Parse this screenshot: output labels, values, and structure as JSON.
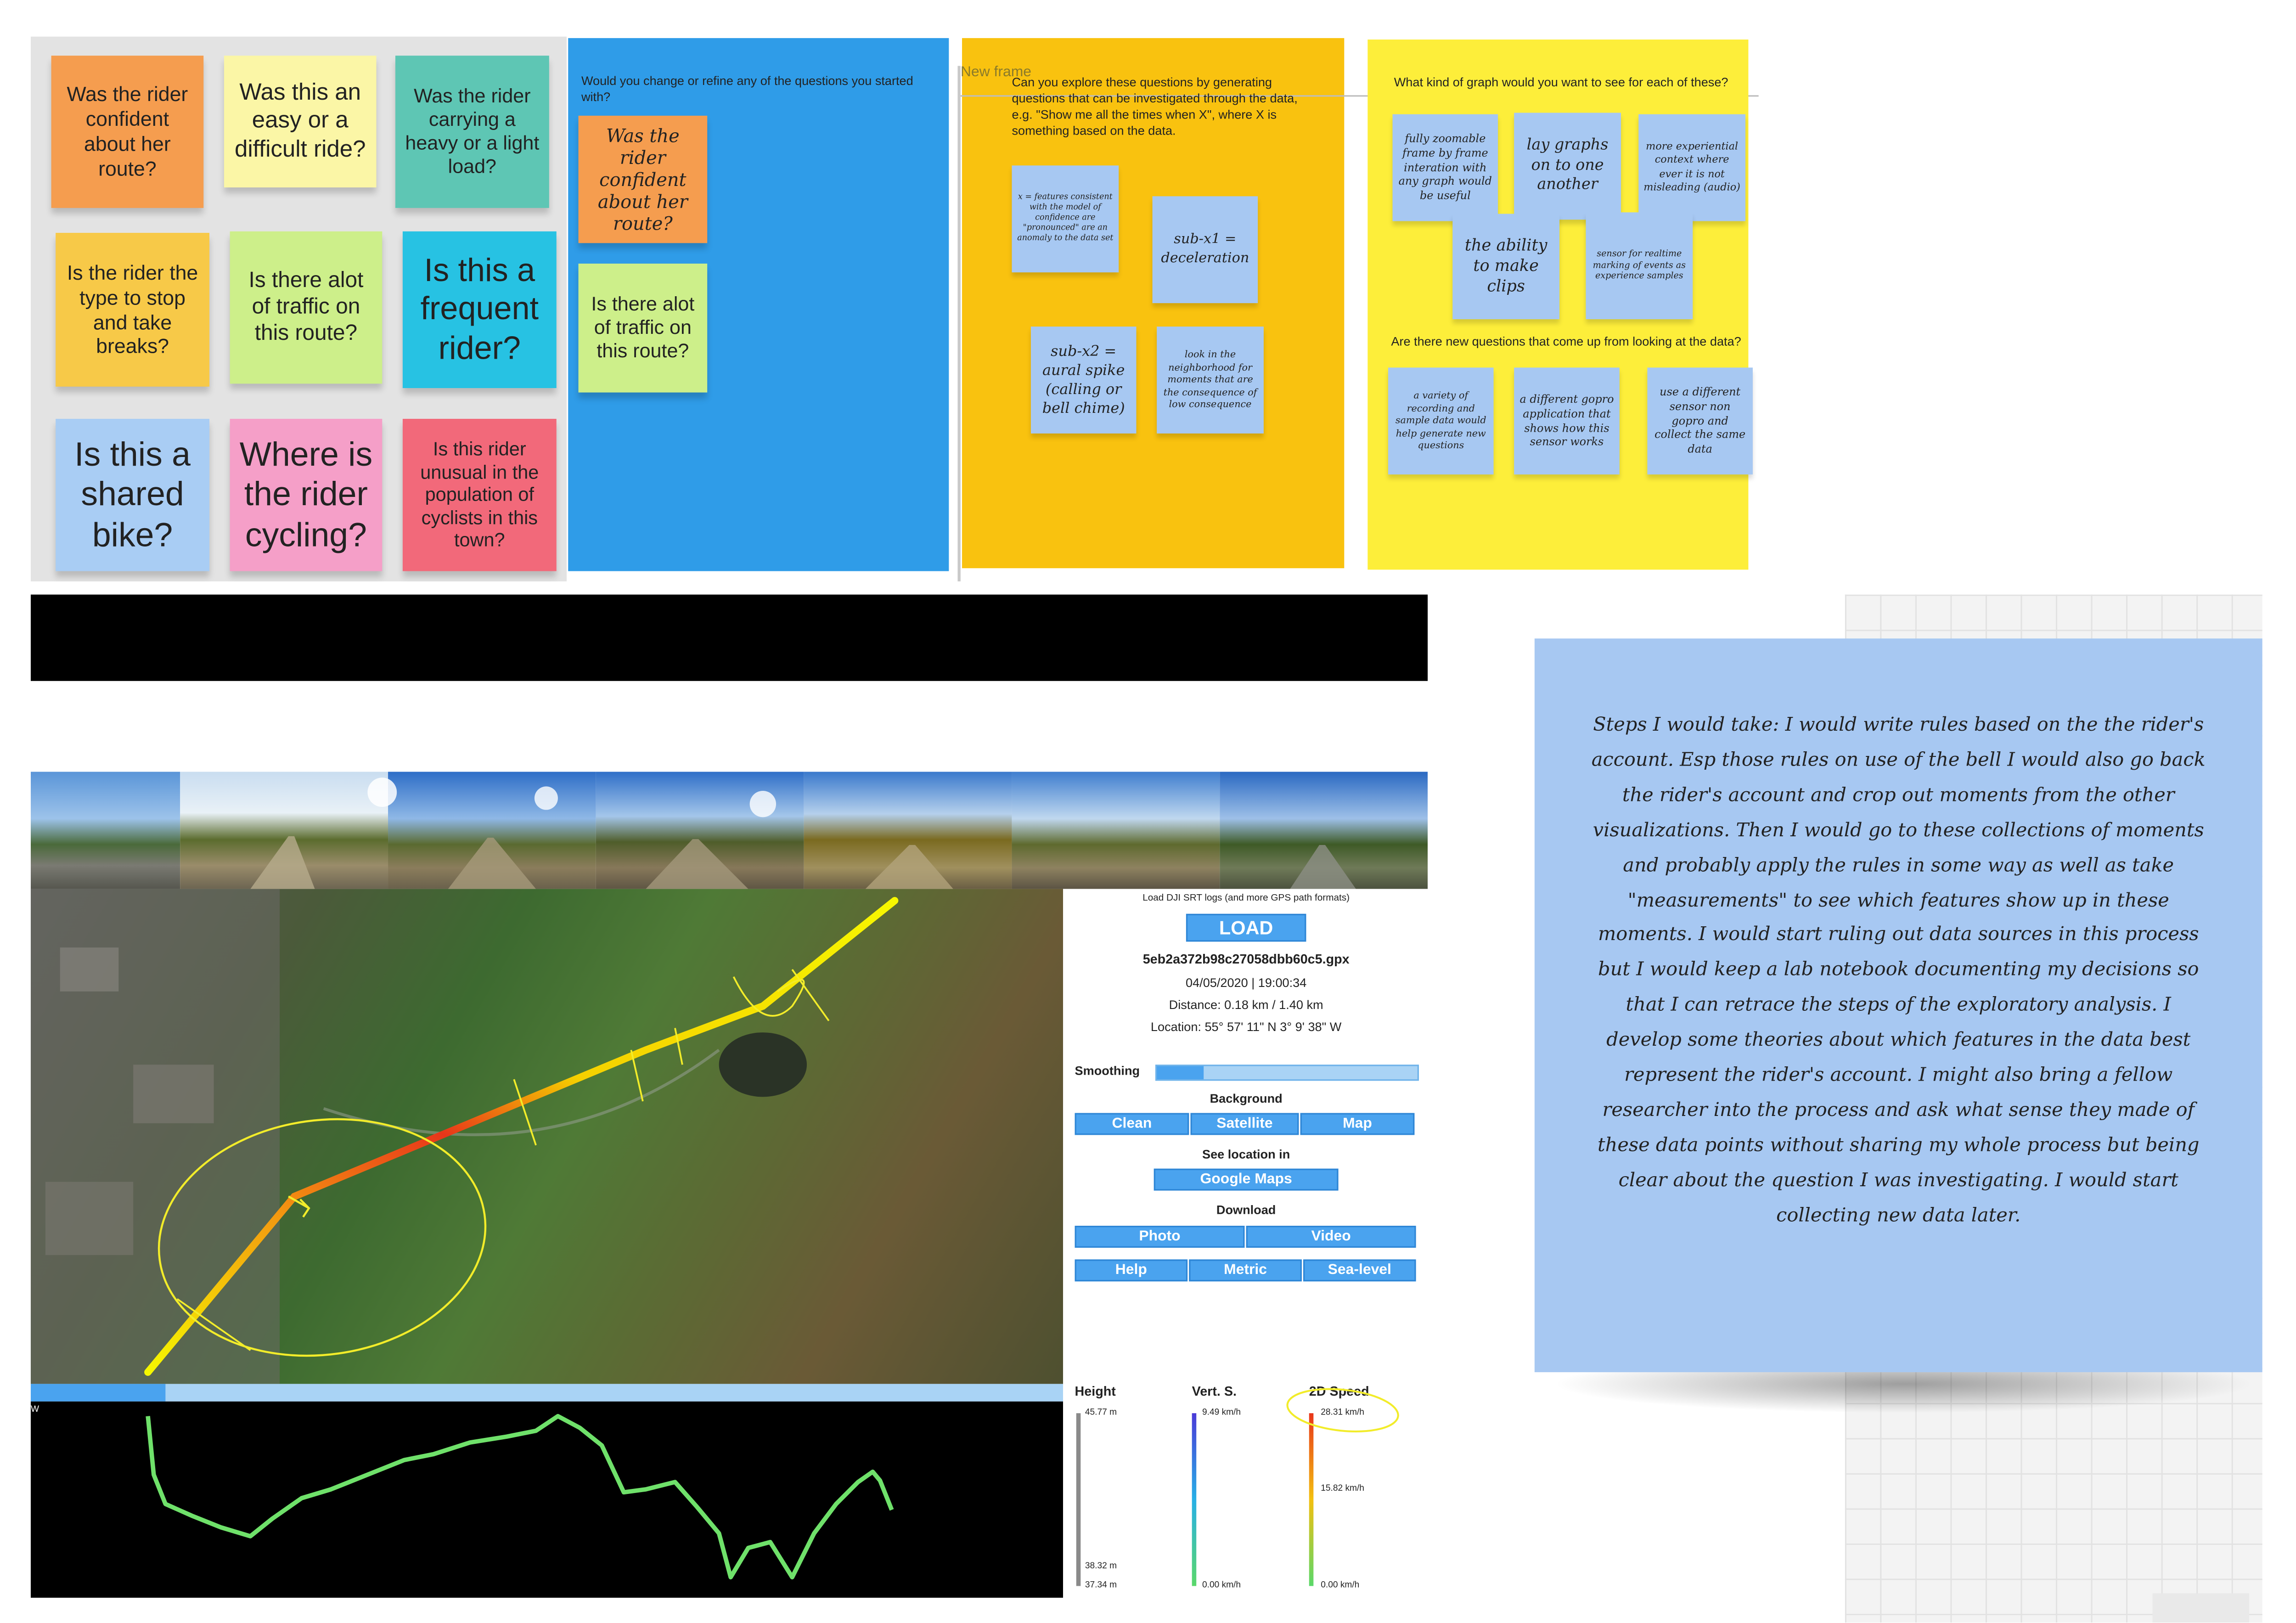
{
  "frame1": {
    "notes": [
      {
        "text": "Was the rider confident about her route?",
        "color": "#f59d4f"
      },
      {
        "text": "Was this an easy or a difficult ride?",
        "color": "#fbf6a6"
      },
      {
        "text": "Was the rider carrying a heavy or a light load?",
        "color": "#5ec6b4"
      },
      {
        "text": "Is the rider the type to stop and take breaks?",
        "color": "#f7c948"
      },
      {
        "text": "Is there alot of traffic on this route?",
        "color": "#cdef8a"
      },
      {
        "text": "Is this a frequent rider?",
        "color": "#27c2e3"
      },
      {
        "text": "Is this a shared bike?",
        "color": "#a9cdf4"
      },
      {
        "text": "Where is the rider cycling?",
        "color": "#f59fc8"
      },
      {
        "text": "Is this rider unusual in the population of cyclists in this town?",
        "color": "#f2697a"
      }
    ]
  },
  "frame2": {
    "question": "Would you change or refine any of the questions you started with?",
    "notes": [
      {
        "text": "Was the rider confident about her route?"
      },
      {
        "text": "Is there alot of traffic on this route?"
      }
    ]
  },
  "frame3": {
    "label": "New frame",
    "question": "Can you explore these questions by generating questions that can be investigated through the data, e.g. \"Show me all the times when X\", where X is something based on the data.",
    "notes": [
      {
        "text": "x = features consistent with the model of confidence are \"pronounced\" are an anomaly to the data set"
      },
      {
        "text": "sub-x1 = deceleration"
      },
      {
        "text": "sub-x2 = aural spike (calling or bell chime)"
      },
      {
        "text": "look in the neighborhood for moments that are the consequence of low consequence"
      }
    ]
  },
  "frame4": {
    "question1": "What kind of graph would you want to see for each of these?",
    "notes1": [
      {
        "text": "fully zoomable frame by frame interation with any graph would be useful"
      },
      {
        "text": "lay graphs on to one another"
      },
      {
        "text": "more experiential context where ever it is not misleading (audio)"
      },
      {
        "text": "the ability to make clips"
      },
      {
        "text": "sensor for realtime marking of events as experience samples"
      }
    ],
    "question2": "Are there new questions that come up from looking at the data?",
    "notes2": [
      {
        "text": "a variety of recording and sample data would help generate new questions"
      },
      {
        "text": "a different gopro application that shows how this sensor works"
      },
      {
        "text": "use a different sensor non gopro and collect the same data"
      }
    ]
  },
  "big_note": {
    "text": "Steps I would take: I would write rules based on the the rider's account. Esp those rules on use of the bell I would also go back the rider's account and crop out moments from the other visualizations. Then I would go to these collections of moments and probably apply the rules in some way as well as take \"measurements\" to see which features show up in these moments. I would start ruling out data sources in this process but I would keep a lab notebook documenting my decisions so that I can retrace the steps of the exploratory analysis. I develop some theories about which features in the data best represent the rider's account. I might also bring a fellow researcher into the process and ask what sense they made of these data points without sharing my whole process but being clear about the question I was investigating.  I would start collecting new data later."
  },
  "panel": {
    "load_hint": "Load DJI SRT logs (and more GPS path formats)",
    "load_button": "LOAD",
    "file_name": "5eb2a372b98c27058dbb60c5.gpx",
    "datetime": "04/05/2020 | 19:00:34",
    "distance": "Distance: 0.18 km / 1.40 km",
    "location": "Location: 55° 57' 11\" N 3° 9' 38\" W",
    "smoothing_label": "Smoothing",
    "smoothing_value": 0.18,
    "background_label": "Background",
    "bg_clean": "Clean",
    "bg_satellite": "Satellite",
    "bg_map": "Map",
    "see_location_label": "See location in",
    "google_maps": "Google Maps",
    "download_label": "Download",
    "photo": "Photo",
    "video": "Video",
    "help": "Help",
    "metric": "Metric",
    "sea_level": "Sea-level"
  },
  "gauges": {
    "height_label": "Height",
    "height_max": "45.77 m",
    "height_mid": "38.32 m",
    "height_min": "37.34 m",
    "vert_label": "Vert. S.",
    "vert_max": "9.49 km/h",
    "vert_min": "0.00 km/h",
    "speed_label": "2D Speed",
    "speed_max": "28.31 km/h",
    "speed_mid": "15.82 km/h",
    "speed_min": "0.00 km/h"
  },
  "timeline": {
    "progress": 0.13,
    "marker": "W"
  },
  "colors": {
    "frame_blue": "#2f9ce8",
    "frame_orange": "#f9c20f",
    "frame_yellow": "#fdee3a",
    "button_blue": "#4aa3ef"
  }
}
